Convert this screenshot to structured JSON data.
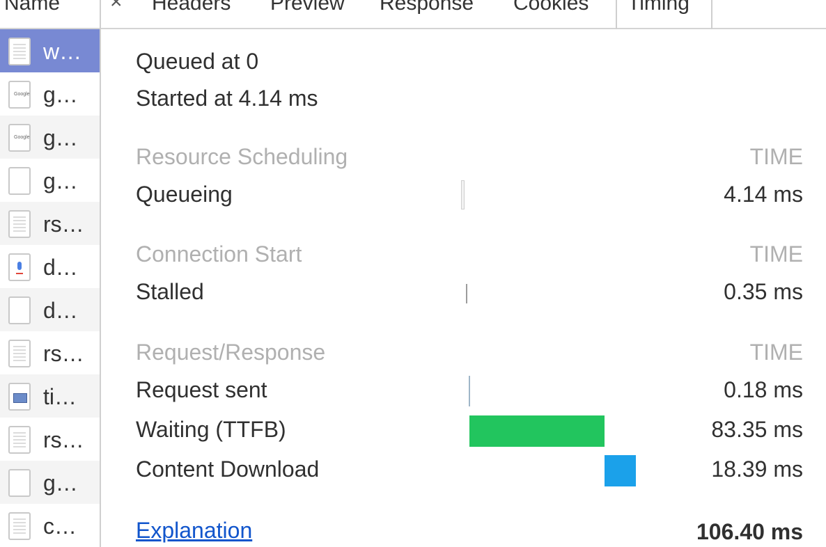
{
  "header": {
    "name_label": "Name",
    "close_glyph": "×",
    "tabs": [
      "Headers",
      "Preview",
      "Response",
      "Cookies",
      "Timing"
    ]
  },
  "sidebar": {
    "items": [
      {
        "label": "w…",
        "icon": "document-icon",
        "selected": true
      },
      {
        "label": "g…",
        "icon": "google-image-icon"
      },
      {
        "label": "g…",
        "icon": "google-image-icon"
      },
      {
        "label": "g…",
        "icon": "blank-file-icon"
      },
      {
        "label": "rs…",
        "icon": "document-icon"
      },
      {
        "label": "d…",
        "icon": "microphone-icon"
      },
      {
        "label": "d…",
        "icon": "blank-file-icon"
      },
      {
        "label": "rs…",
        "icon": "document-icon"
      },
      {
        "label": "ti…",
        "icon": "image-thumbnail-icon"
      },
      {
        "label": "rs…",
        "icon": "document-icon"
      },
      {
        "label": "g…",
        "icon": "blank-file-icon"
      },
      {
        "label": "c…",
        "icon": "document-icon"
      }
    ]
  },
  "timing": {
    "queued_at": "Queued at 0",
    "started_at": "Started at 4.14 ms",
    "time_header": "TIME",
    "sections": [
      {
        "title": "Resource Scheduling",
        "rows": [
          {
            "label": "Queueing",
            "value": "4.14 ms"
          }
        ]
      },
      {
        "title": "Connection Start",
        "rows": [
          {
            "label": "Stalled",
            "value": "0.35 ms"
          }
        ]
      },
      {
        "title": "Request/Response",
        "rows": [
          {
            "label": "Request sent",
            "value": "0.18 ms"
          },
          {
            "label": "Waiting (TTFB)",
            "value": "83.35 ms",
            "color": "#22c55e"
          },
          {
            "label": "Content Download",
            "value": "18.39 ms",
            "color": "#1ba1ea"
          }
        ]
      }
    ],
    "explanation_link": "Explanation",
    "total": "106.40 ms",
    "colors": {
      "waiting": "#22c55e",
      "download": "#1ba1ea",
      "selected_row": "#7889d3",
      "section_title": "#b0b0b0",
      "link": "#1155cc"
    }
  }
}
